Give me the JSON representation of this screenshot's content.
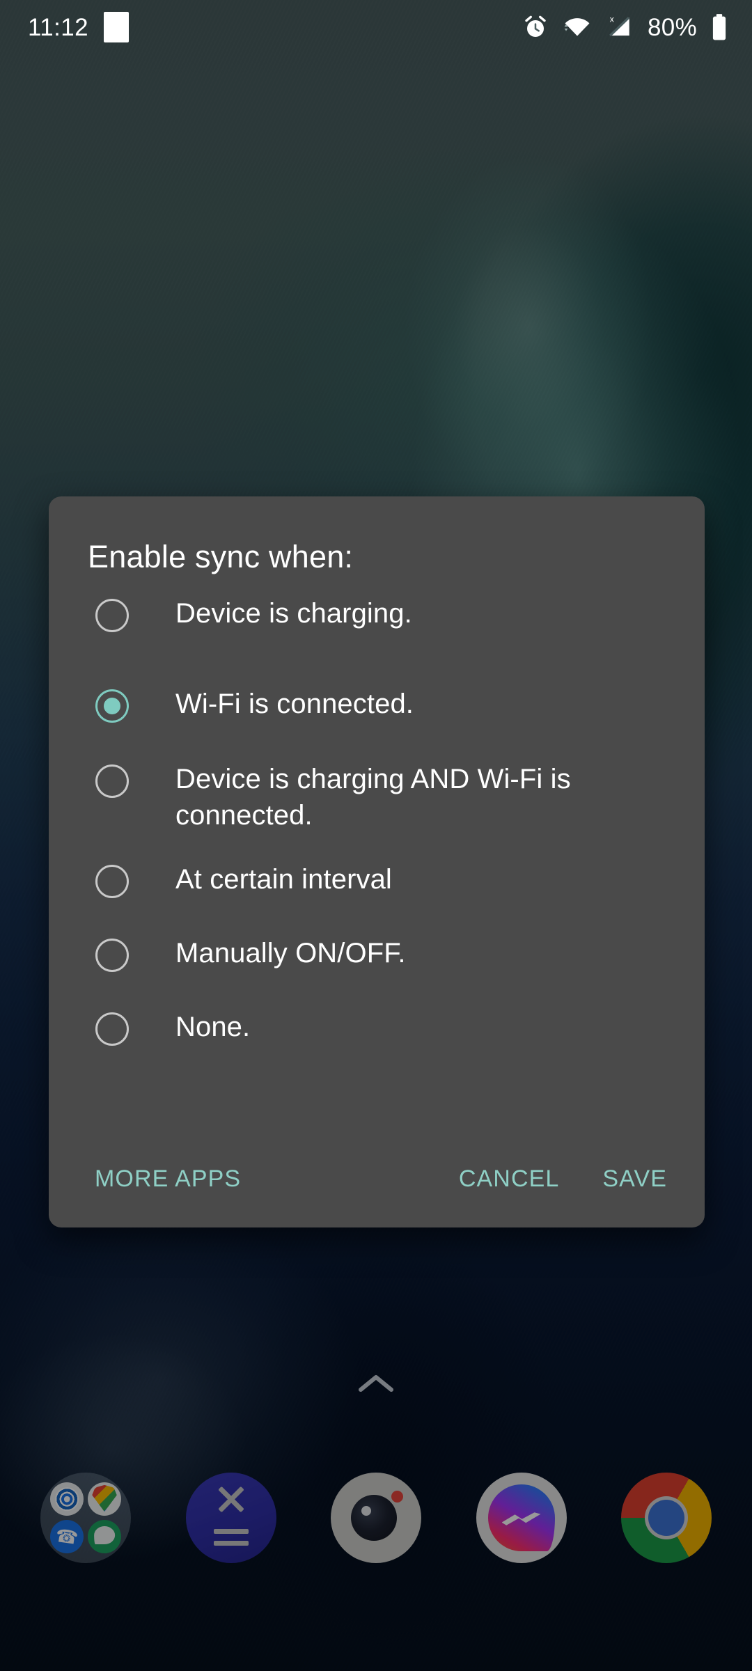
{
  "status_bar": {
    "time": "11:12",
    "battery_percent": "80%",
    "icons": {
      "notification": "notification-square-icon",
      "alarm": "alarm-clock-icon",
      "wifi": "wifi-icon",
      "signal": "no-sim-signal-icon",
      "battery": "battery-icon"
    }
  },
  "dialog": {
    "title": "Enable sync when:",
    "options": [
      {
        "label": "Device is charging.",
        "selected": false
      },
      {
        "label": "Wi-Fi is connected.",
        "selected": true
      },
      {
        "label": "Device is charging AND Wi-Fi is connected.",
        "selected": false
      },
      {
        "label": "At certain interval",
        "selected": false
      },
      {
        "label": "Manually ON/OFF.",
        "selected": false
      },
      {
        "label": "None.",
        "selected": false
      }
    ],
    "buttons": {
      "more_apps": "MORE APPS",
      "cancel": "CANCEL",
      "save": "SAVE"
    },
    "colors": {
      "surface": "#4a4a4a",
      "accent": "#8fd0c6",
      "radio_selected": "#7fcbc0",
      "radio_unselected": "#c9c9c9",
      "text": "#ffffff"
    }
  },
  "home_screen": {
    "app_drawer_handle": "chevron-up-icon",
    "dock": [
      {
        "name": "app-folder",
        "icon": "folder-icon"
      },
      {
        "name": "calculator",
        "icon": "calculator-icon"
      },
      {
        "name": "camera",
        "icon": "camera-icon"
      },
      {
        "name": "messenger",
        "icon": "messenger-icon"
      },
      {
        "name": "chrome",
        "icon": "chrome-icon"
      }
    ]
  }
}
